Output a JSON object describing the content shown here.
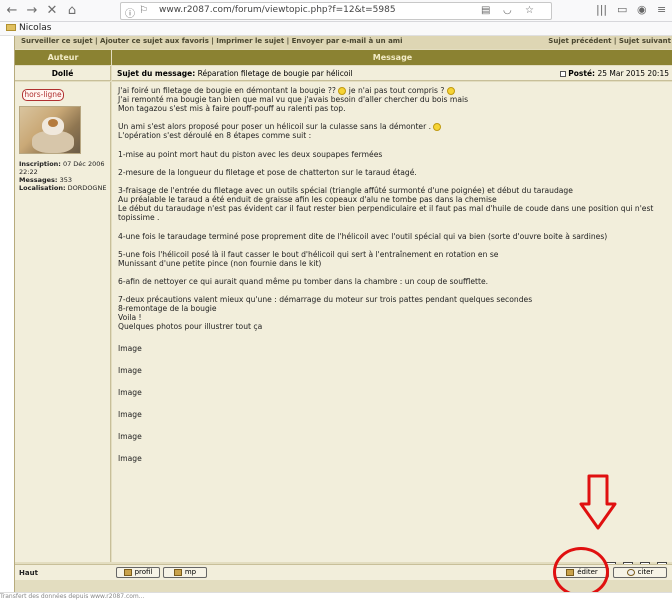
{
  "browser": {
    "url": "www.r2087.com/forum/viewtopic.php?f=12&t=5985",
    "bookmark": "Nicolas"
  },
  "topbar": {
    "left": "Surveiller ce sujet | Ajouter ce sujet aux favoris | Imprimer le sujet | Envoyer par e-mail à un ami",
    "right": "Sujet précédent | Sujet suivant"
  },
  "table": {
    "col_author": "Auteur",
    "col_message": "Message"
  },
  "post": {
    "author": "Dollé",
    "subject_label": "Sujet du message:",
    "subject": "Réparation filetage de bougie par hélicoil",
    "posted_label": "Posté:",
    "posted_date": "25 Mar 2015 20:15",
    "status": "hors-ligne",
    "info": {
      "inscription_label": "Inscription:",
      "inscription": "07 Déc 2006 22:22",
      "messages_label": "Messages:",
      "messages": "353",
      "localisation_label": "Localisation:",
      "localisation": "DORDOGNE"
    },
    "body_lines": [
      "J'ai foiré un filetage de bougie en démontant la bougie ?? [s] je n'ai pas tout compris ? [s]",
      "J'ai remonté ma bougie tan bien que mal vu que j'avais besoin d'aller chercher du bois mais",
      "Mon tagazou s'est mis à faire pouff-pouff au ralenti pas top.",
      "",
      "Un ami s'est alors proposé pour poser un hélicoil sur la culasse sans la démonter . [s]",
      "L'opération s'est déroulé en 8 étapes comme suit :",
      "",
      "1-mise au point mort haut du piston avec les deux soupapes fermées",
      "",
      "2-mesure de la longueur du filetage et pose de chatterton sur le taraud étagé.",
      "",
      "3-fraisage de l'entrée du filetage avec un outils spécial (triangle affûté surmonté d'une poignée) et début du taraudage",
      "Au préalable le taraud a été enduit de graisse afin les copeaux d'alu ne tombe pas dans la chemise",
      "Le début du taraudage n'est pas évident car il faut rester bien perpendiculaire et il faut pas mal d'huile de coude dans une position qui n'est topissime .",
      "",
      "4-une fois le taraudage terminé pose proprement dite de l'hélicoil avec l'outil spécial qui va bien (sorte d'ouvre boite à sardines)",
      "",
      "5-une fois l'hélicoil posé là il faut casser le bout d'hélicoil qui sert à l'entraînement en rotation en se",
      "Munissant d'une petite pince (non fournie dans le kit)",
      "",
      "6-afin de nettoyer ce qui aurait quand même pu tomber dans la chambre : un coup de soufflette.",
      "",
      "7-deux précautions valent mieux qu'une : démarrage du moteur sur trois pattes pendant quelques secondes",
      "8-remontage de la bougie",
      "Voila !",
      "Quelques photos pour illustrer tout ça"
    ],
    "images": [
      "Image",
      "Image",
      "Image",
      "Image",
      "Image",
      "Image"
    ]
  },
  "footer": {
    "haut": "Haut",
    "profil": "profil",
    "mp": "mp",
    "editer": "éditer",
    "citer": "citer"
  },
  "status_text": "Transfert des données depuis www.r2087.com..."
}
